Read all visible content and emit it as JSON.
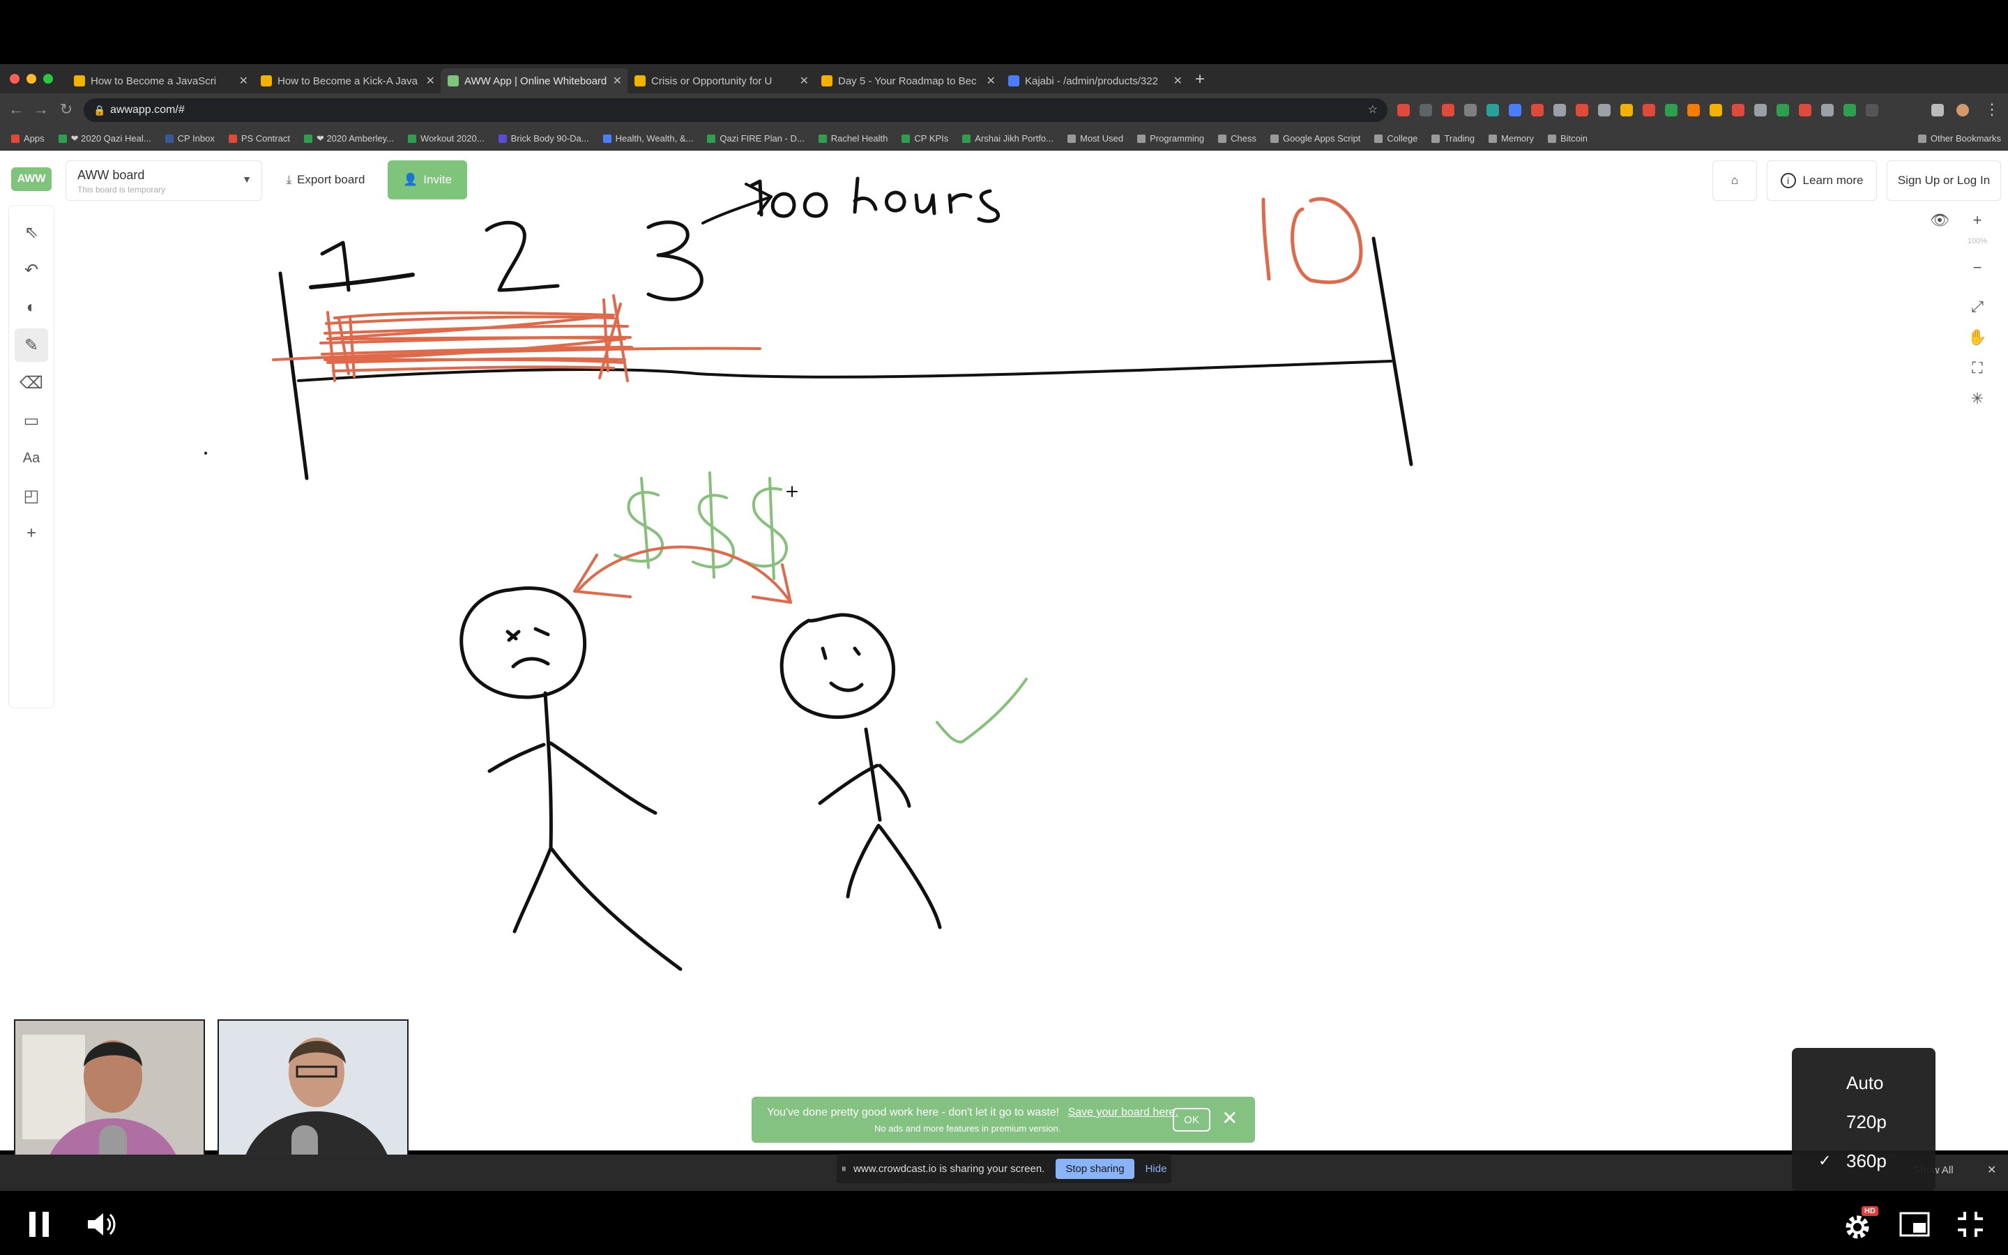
{
  "browser": {
    "tabs": [
      {
        "title": "How to Become a JavaScri",
        "favicon_color": "#f2b300"
      },
      {
        "title": "How to Become a Kick-A Java",
        "favicon_color": "#f2b300"
      },
      {
        "title": "AWW App | Online Whiteboard",
        "favicon_color": "#7fc47b",
        "active": true
      },
      {
        "title": "Crisis or Opportunity for U",
        "favicon_color": "#f2b300"
      },
      {
        "title": "Day 5 - Your Roadmap to Bec",
        "favicon_color": "#f2b300"
      },
      {
        "title": "Kajabi - /admin/products/322",
        "favicon_color": "#4a7dff"
      }
    ],
    "new_tab_icon": "plus-icon",
    "address": "awwapp.com/#",
    "bookmarks": [
      {
        "label": "Apps",
        "color": "#e04a3a"
      },
      {
        "label": "❤ 2020 Qazi Heal...",
        "color": "#2e9e4f"
      },
      {
        "label": "CP Inbox",
        "color": "#3b5998"
      },
      {
        "label": "PS Contract",
        "color": "#e04a3a"
      },
      {
        "label": "❤ 2020 Amberley...",
        "color": "#2e9e4f"
      },
      {
        "label": "Workout 2020...",
        "color": "#2e9e4f"
      },
      {
        "label": "Brick Body 90-Da...",
        "color": "#5b4bd6"
      },
      {
        "label": "Health, Wealth, &...",
        "color": "#4a7dff"
      },
      {
        "label": "Qazi FIRE Plan - D...",
        "color": "#2e9e4f"
      },
      {
        "label": "Rachel Health",
        "color": "#2e9e4f"
      },
      {
        "label": "CP KPIs",
        "color": "#2e9e4f"
      },
      {
        "label": "Arshai Jikh Portfo...",
        "color": "#2e9e4f"
      },
      {
        "label": "Most Used",
        "color": "#9a9a9a"
      },
      {
        "label": "Programming",
        "color": "#9a9a9a"
      },
      {
        "label": "Chess",
        "color": "#9a9a9a"
      },
      {
        "label": "Google Apps Script",
        "color": "#9a9a9a"
      },
      {
        "label": "College",
        "color": "#9a9a9a"
      },
      {
        "label": "Trading",
        "color": "#9a9a9a"
      },
      {
        "label": "Memory",
        "color": "#9a9a9a"
      },
      {
        "label": "Bitcoin",
        "color": "#9a9a9a"
      }
    ],
    "other_bookmarks": "Other Bookmarks"
  },
  "app": {
    "logo": "AWW",
    "board_name": "AWW board",
    "board_sub": "This board is temporary",
    "export": "Export board",
    "invite": "Invite",
    "learn_more": "Learn more",
    "signup": "Sign Up or Log In",
    "zoom": "100%",
    "tools": [
      "cursor-icon",
      "undo-icon",
      "palette-icon",
      "pen-icon",
      "eraser-icon",
      "rectangle-icon",
      "text-icon",
      "sticky-note-icon",
      "plus-icon"
    ],
    "text_tool_label": "Aa"
  },
  "whiteboard": {
    "colors": {
      "ink": "#111111",
      "orange": "#e0694a",
      "green": "#86c07a"
    }
  },
  "notices": {
    "toast_line1": "You've done pretty good work here - don't let it go to waste!",
    "toast_link": "Save your board here.",
    "toast_line2": "No ads and more features in premium version.",
    "toast_ok": "OK",
    "share_text": "www.crowdcast.io is sharing your screen.",
    "stop_sharing": "Stop sharing",
    "hide": "Hide",
    "show_all": "Show All"
  },
  "player": {
    "quality_options": [
      "Auto",
      "720p",
      "360p"
    ],
    "quality_selected": "360p",
    "hd_badge": "HD"
  }
}
